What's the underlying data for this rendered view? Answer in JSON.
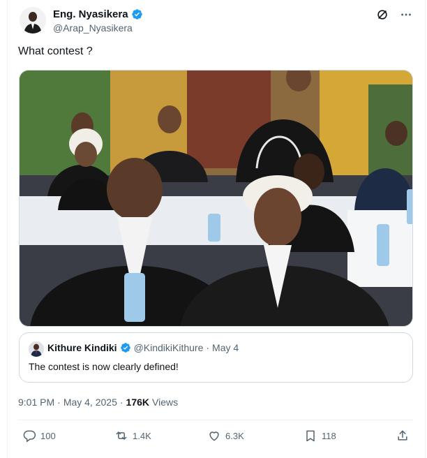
{
  "author": {
    "name": "Eng. Nyasikera",
    "handle": "@Arap_Nyasikera"
  },
  "tweet": {
    "text": "What contest ?"
  },
  "quote": {
    "name": "Kithure Kindiki",
    "handle": "@KindikiKithure",
    "dot": "·",
    "date": "May 4",
    "text": "The contest is now clearly defined!"
  },
  "meta": {
    "time": "9:01 PM",
    "sep": "·",
    "date": "May 4, 2025",
    "sep2": "·",
    "views_count": "176K",
    "views_label": "Views"
  },
  "actions": {
    "replies": "100",
    "reposts": "1.4K",
    "likes": "6.3K",
    "bookmarks": "118"
  },
  "colors": {
    "verified": "#1d9bf0",
    "text": "#0f1419",
    "secondary": "#536471",
    "border": "#cfd9de"
  },
  "icons": [
    "grok-icon",
    "more-icon",
    "reply-icon",
    "repost-icon",
    "like-icon",
    "bookmark-icon",
    "share-icon",
    "verified-badge-icon"
  ]
}
